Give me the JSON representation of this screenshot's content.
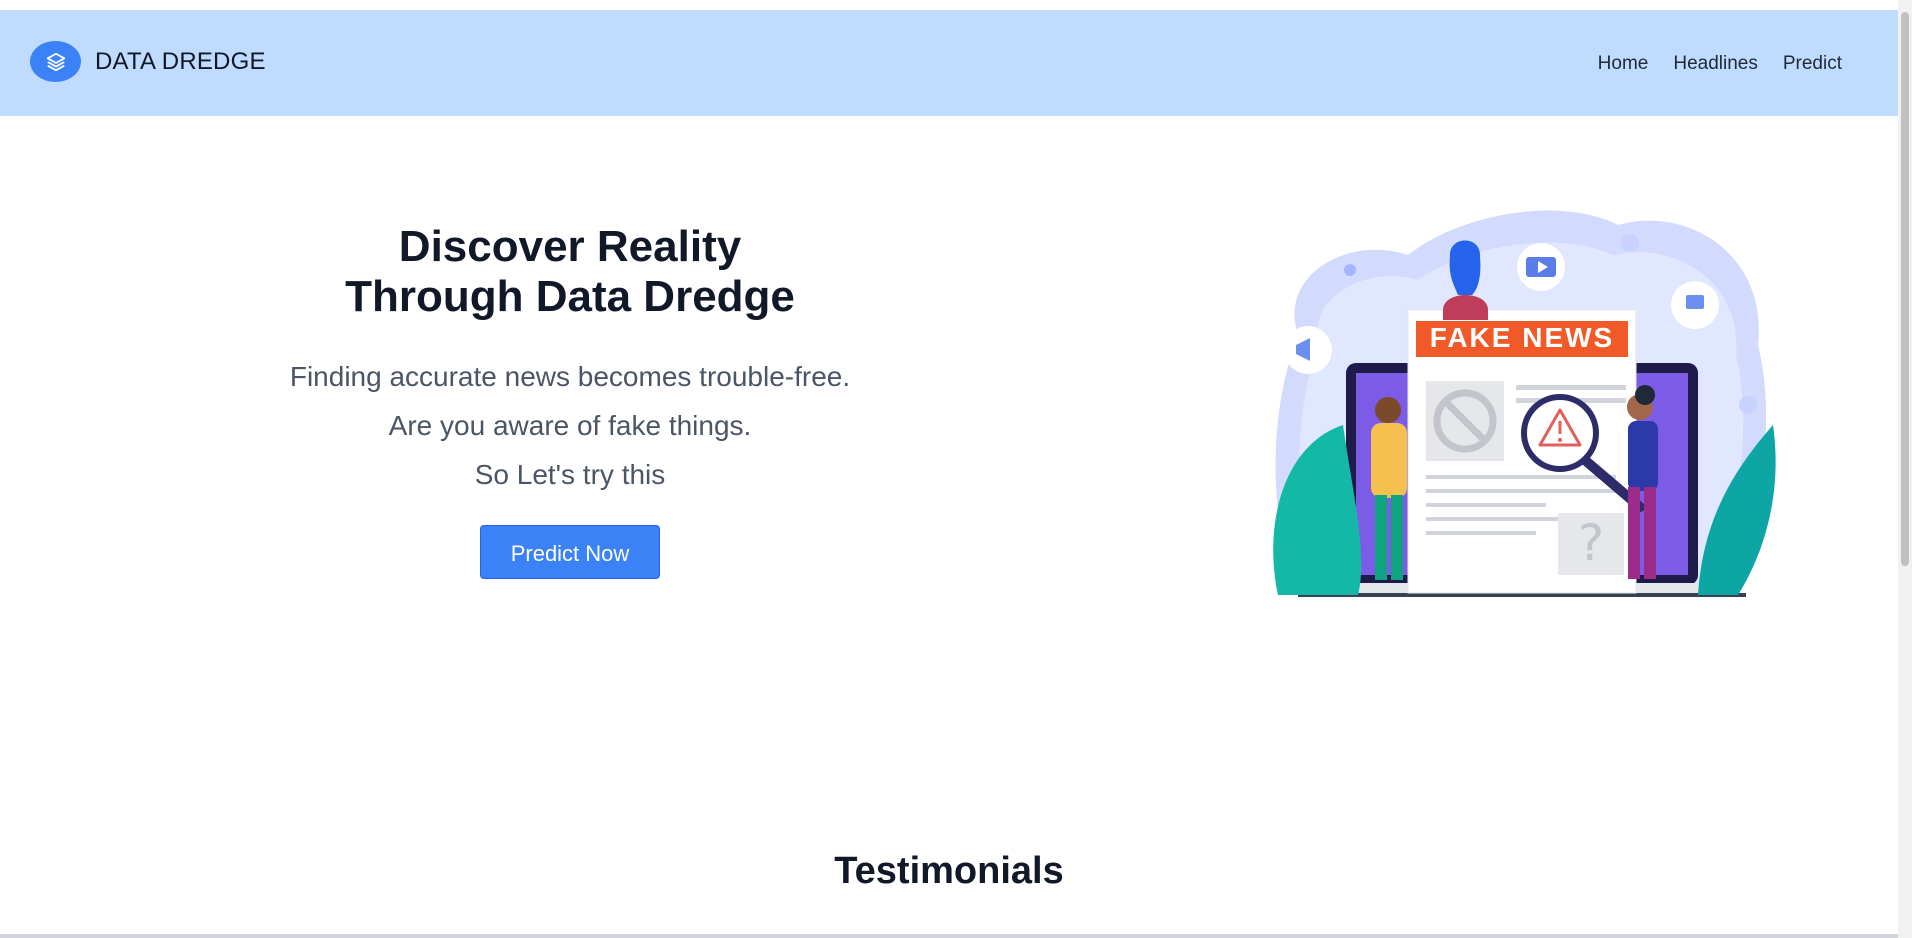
{
  "brand": {
    "name": "DATA DREDGE",
    "logo_icon": "stack-layers-icon"
  },
  "nav": {
    "items": [
      {
        "label": "Home"
      },
      {
        "label": "Headlines"
      },
      {
        "label": "Predict"
      }
    ]
  },
  "hero": {
    "title_line1": "Discover Reality",
    "title_line2": "Through Data Dredge",
    "subtitle_line1": "Finding accurate news becomes trouble-free.",
    "subtitle_line2": "Are you aware of fake things.",
    "subtitle_line3": "So Let's try this",
    "cta_label": "Predict Now"
  },
  "illustration": {
    "banner_text": "FAKE NEWS"
  },
  "testimonials": {
    "heading": "Testimonials"
  },
  "colors": {
    "navbar_bg": "#bfdbfe",
    "accent": "#3b82f6",
    "banner": "#f05a28"
  }
}
